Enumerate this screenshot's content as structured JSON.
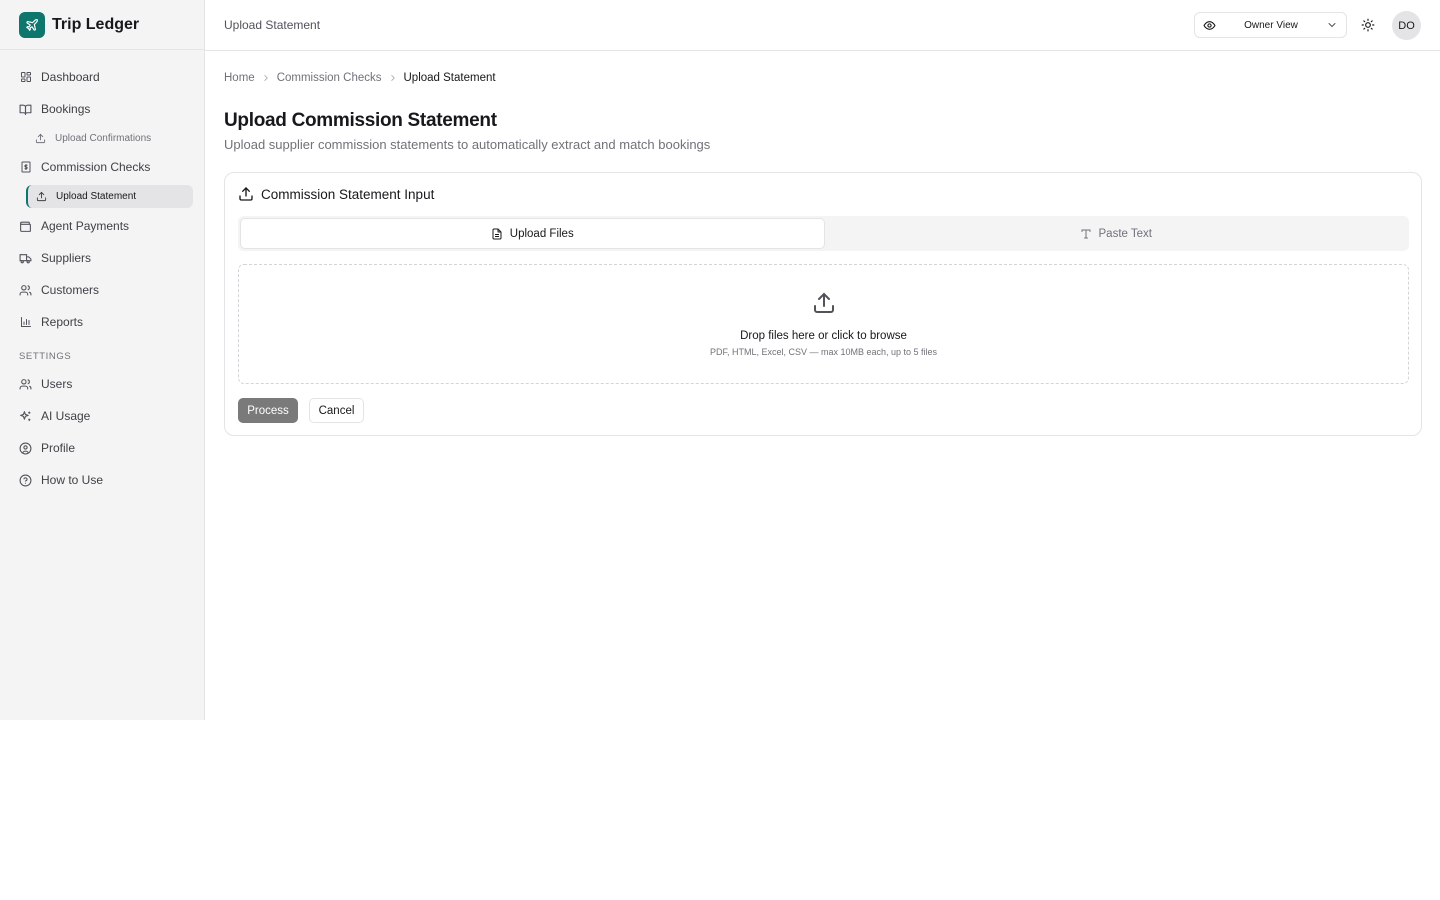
{
  "app": {
    "name": "Trip Ledger",
    "logo_icon": "plane-icon",
    "accent": "#0f766e"
  },
  "sidebar": {
    "items": [
      {
        "label": "Dashboard",
        "icon": "grid-icon"
      },
      {
        "label": "Bookings",
        "icon": "book-icon"
      },
      {
        "label": "Upload Confirmations",
        "icon": "upload-icon"
      },
      {
        "label": "Commission Checks",
        "icon": "receipt-icon"
      },
      {
        "label": "Upload Statement",
        "icon": "upload-icon"
      },
      {
        "label": "Agent Payments",
        "icon": "wallet-icon"
      },
      {
        "label": "Suppliers",
        "icon": "truck-icon"
      },
      {
        "label": "Customers",
        "icon": "users-icon"
      },
      {
        "label": "Reports",
        "icon": "bar-chart-icon"
      }
    ],
    "settings_label": "SETTINGS",
    "settings_items": [
      {
        "label": "Users",
        "icon": "users-icon"
      },
      {
        "label": "AI Usage",
        "icon": "sparkles-icon"
      },
      {
        "label": "Profile",
        "icon": "user-circle-icon"
      },
      {
        "label": "How to Use",
        "icon": "help-circle-icon"
      }
    ]
  },
  "header": {
    "title": "Upload Statement",
    "view_select": {
      "value": "Owner View"
    },
    "avatar_initials": "DO"
  },
  "breadcrumb": [
    "Home",
    "Commission Checks",
    "Upload Statement"
  ],
  "page": {
    "title": "Upload Commission Statement",
    "subtitle": "Upload supplier commission statements to automatically extract and match bookings"
  },
  "card": {
    "title": "Commission Statement Input",
    "tabs": [
      {
        "label": "Upload Files",
        "active": true
      },
      {
        "label": "Paste Text",
        "active": false
      }
    ],
    "dropzone": {
      "title": "Drop files here or click to browse",
      "hint": "PDF, HTML, Excel, CSV — max 10MB each, up to 5 files"
    },
    "process_label": "Process",
    "cancel_label": "Cancel"
  }
}
